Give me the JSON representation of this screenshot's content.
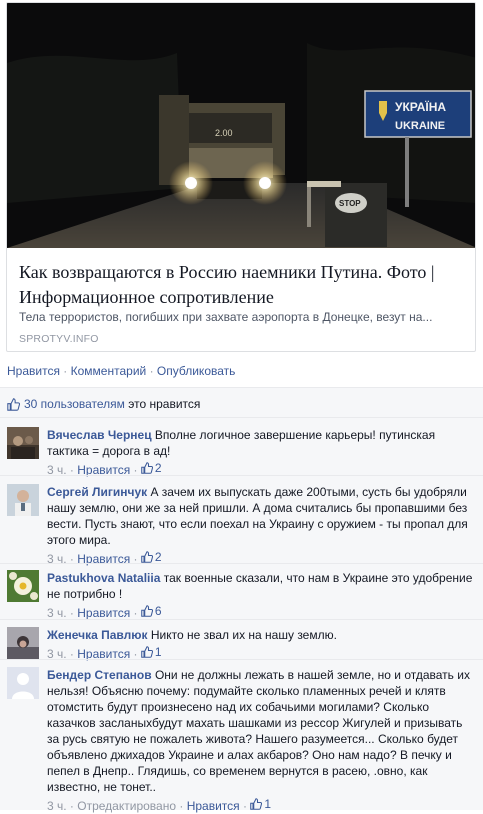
{
  "post": {
    "image_alt": "Грузовик ночью на границе, знак УКРАЇНА UKRAINE",
    "sign": {
      "line1": "УКРАЇНА",
      "line2": "UKRAINE",
      "stop": "STOP",
      "truck_plate": "2.00"
    },
    "title": "Как возвращаются в Россию наемники Путина. Фото | Информационное сопротивление",
    "description": "Тела террористов, погибших при захвате аэропорта в Донецке, везут на...",
    "source": "SPROTYV.INFO"
  },
  "actions": {
    "like": "Нравится",
    "dot": "·",
    "comment": "Комментарий",
    "share": "Опубликовать"
  },
  "likes": {
    "count_text": "30 пользователям",
    "suffix": "это нравится"
  },
  "comments": [
    {
      "author": "Вячеслав Чернец",
      "text": "Вполне логичное завершение карьеры! путинская тактика = дорога в ад!",
      "time": "3 ч.",
      "like": "Нравится",
      "likes": "2",
      "avatar": "avatar-photo"
    },
    {
      "author": "Сергей Лигинчук",
      "text": "А зачем их выпускать даже 200тыми, сусть бы удобряли нашу землю, они же за ней пришли. А дома считались бы пропавшими без вести. Пусть знают, что если поехал на Украину с оружием - ты пропал для этого мира.",
      "time": "3 ч.",
      "like": "Нравится",
      "likes": "2",
      "avatar": "avatar-photo"
    },
    {
      "author": "Pastukhova Nataliia",
      "text": "так военные сказали, что нам в Украине это удобрение не потрибно !",
      "time": "3 ч.",
      "like": "Нравится",
      "likes": "6",
      "avatar": "avatar-photo"
    },
    {
      "author": "Женечка Павлюк",
      "text": "Никто не звал их на нашу землю.",
      "time": "3 ч.",
      "like": "Нравится",
      "likes": "1",
      "avatar": "avatar-photo"
    },
    {
      "author": "Бендер Степанов",
      "text": "Они не должны лежать в нашей земле, но и отдавать их нельзя! Объясню почему: подумайте сколько пламенных речей и клятв отомстить будут произнесено над их собачьими могилами? Сколько казачков засланыхбудут махать шашками из рессор Жигулей и призывать за русь святую не пожалеть живота? Нашего разумеется... Сколько будет объявлено джихадов Украине и алах акбаров? Оно нам надо? В печку и пепел в Днепр.. Глядишь, со временем вернутся в расею, .овно, как известно, не тонет..",
      "time": "3 ч.",
      "edited": "Отредактировано",
      "like": "Нравится",
      "likes": "1",
      "avatar": "default-avatar"
    }
  ],
  "colors": {
    "link": "#3b5998",
    "muted": "#9197a3",
    "feedback_bg": "#f6f7f9"
  }
}
